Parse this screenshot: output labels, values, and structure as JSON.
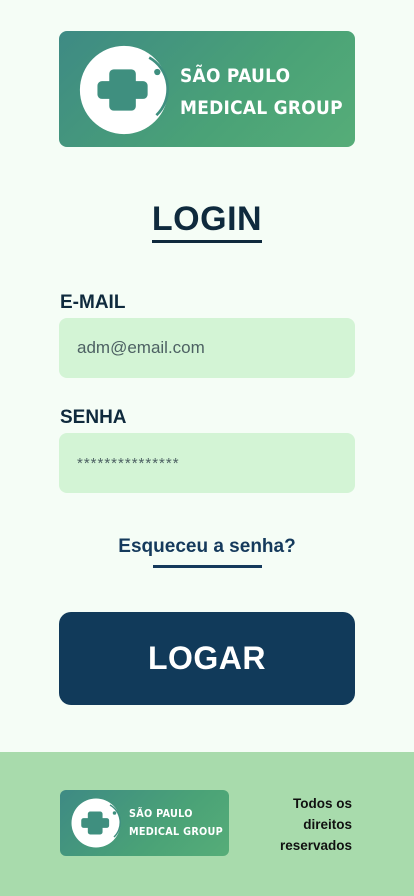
{
  "brand": {
    "name_line1": "SÃO PAULO",
    "name_line2": "MEDICAL GROUP",
    "logo_icon": "medical-cross-icon",
    "gradient_start": "#3e8a84",
    "gradient_end": "#56ad78"
  },
  "login": {
    "title": "LOGIN",
    "email_label": "E-MAIL",
    "email_value": "adm@email.com",
    "password_label": "SENHA",
    "password_value": "***************",
    "forgot_link": "Esqueceu a senha?",
    "submit_label": "LOGAR"
  },
  "footer": {
    "rights_text": "Todos os direitos reservados"
  },
  "colors": {
    "background": "#f5fdf6",
    "input_bg": "#d3f4d5",
    "primary": "#113a5a",
    "footer_bg": "#a8dbac",
    "text_dark": "#0f2a3d"
  }
}
